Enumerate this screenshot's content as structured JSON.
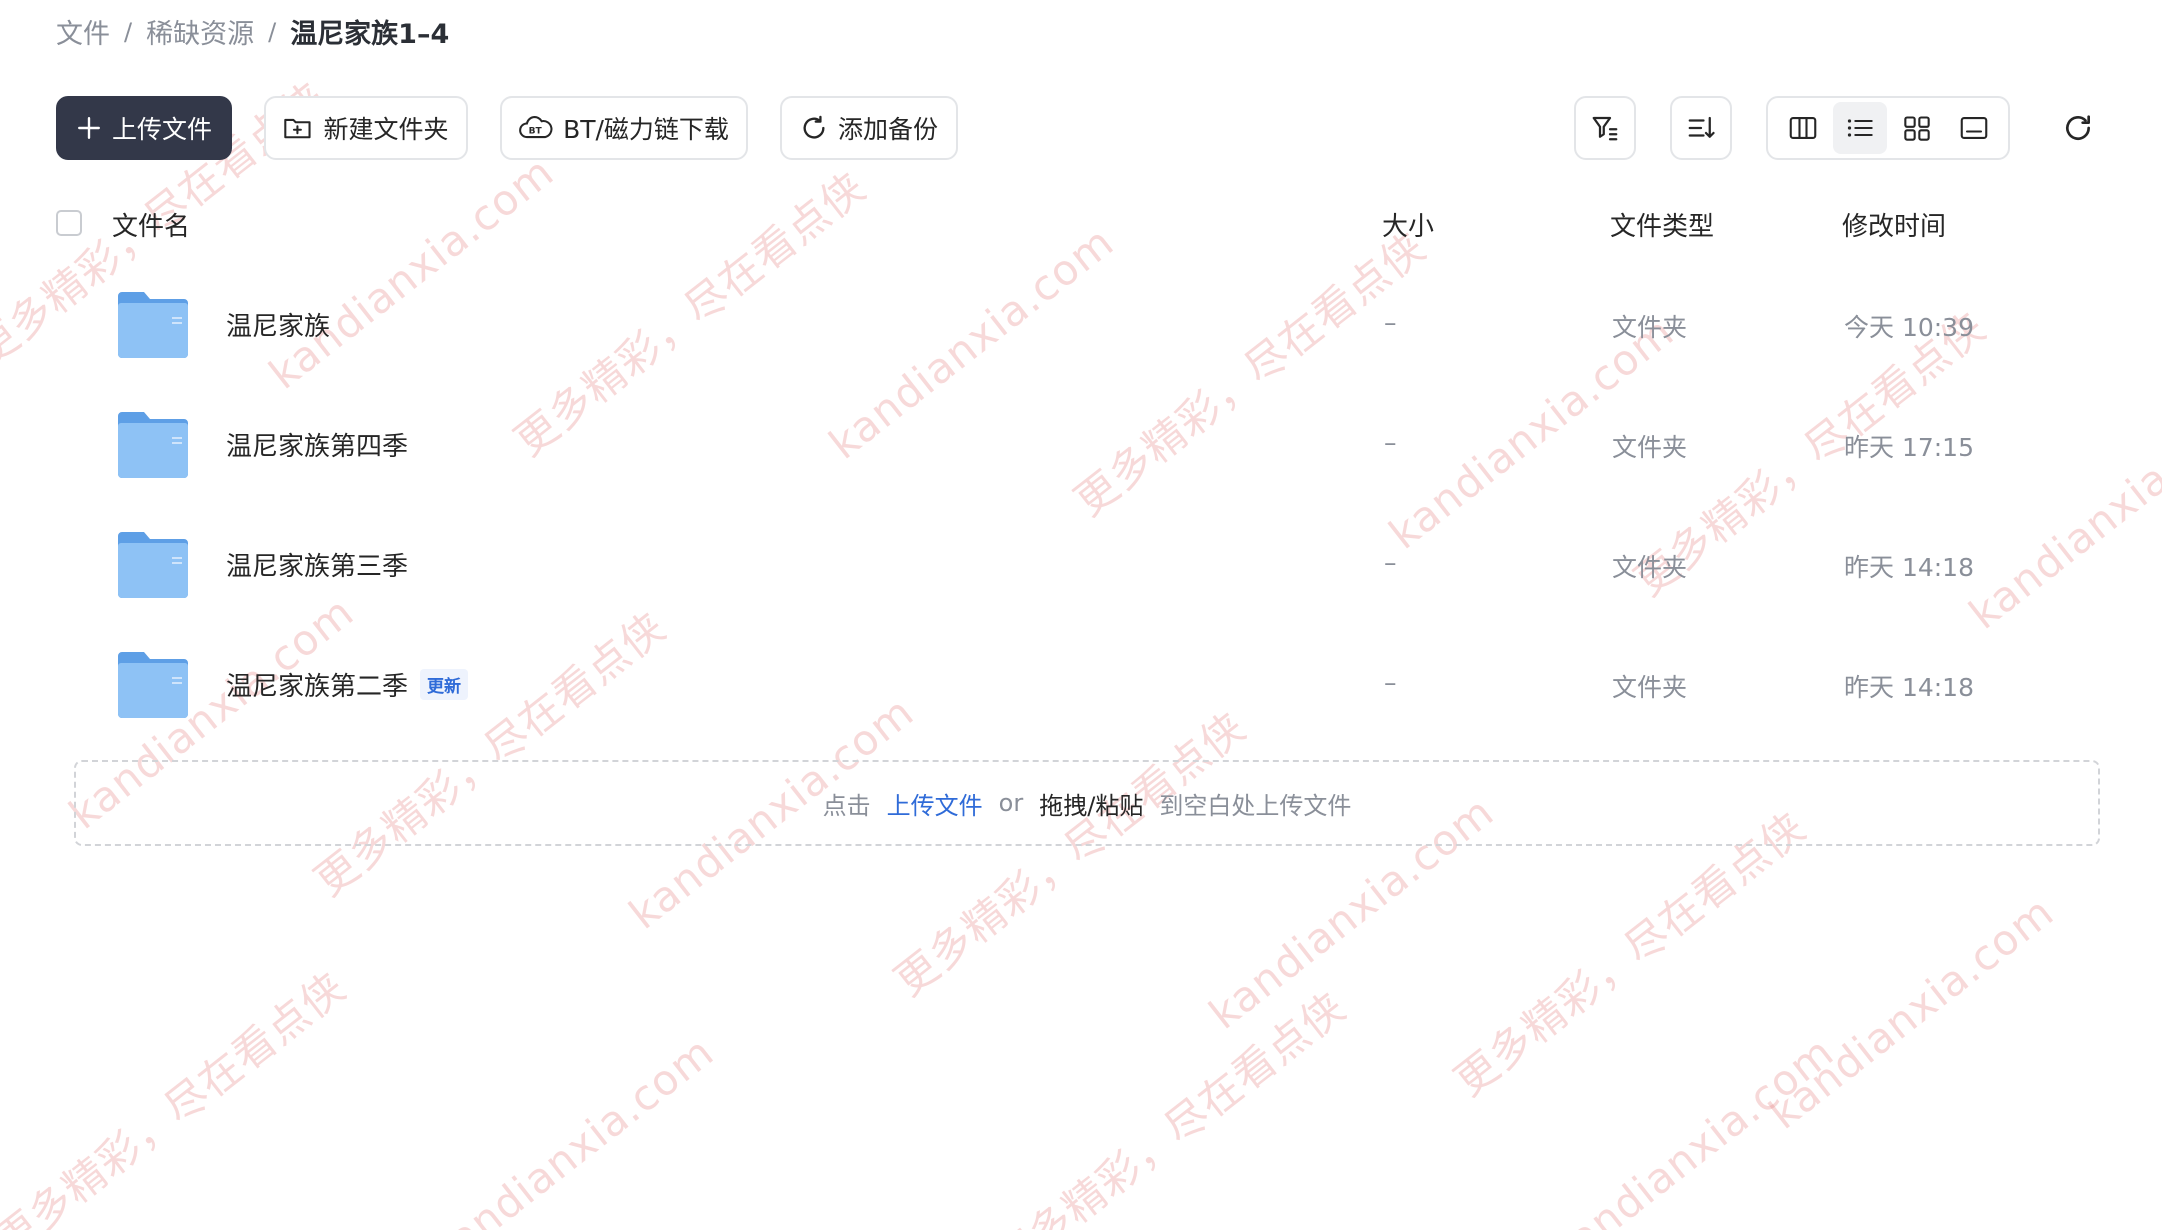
{
  "breadcrumb": [
    "文件",
    "稀缺资源",
    "温尼家族1–4"
  ],
  "toolbar": {
    "upload_label": "上传文件",
    "new_folder_label": "新建文件夹",
    "bt_download_label": "BT/磁力链下载",
    "add_backup_label": "添加备份"
  },
  "table": {
    "headers": {
      "name": "文件名",
      "size": "大小",
      "type": "文件类型",
      "modified": "修改时间"
    },
    "rows": [
      {
        "name": "温尼家族",
        "size": "–",
        "type": "文件夹",
        "modified": "今天 10:39",
        "badge": ""
      },
      {
        "name": "温尼家族第四季",
        "size": "–",
        "type": "文件夹",
        "modified": "昨天 17:15",
        "badge": ""
      },
      {
        "name": "温尼家族第三季",
        "size": "–",
        "type": "文件夹",
        "modified": "昨天 14:18",
        "badge": ""
      },
      {
        "name": "温尼家族第二季",
        "size": "–",
        "type": "文件夹",
        "modified": "昨天 14:18",
        "badge": "更新"
      }
    ]
  },
  "dropzone": {
    "prefix": "点击",
    "upload_link": "上传文件",
    "or": "or",
    "drag_paste": "拖拽/粘贴",
    "suffix": "到空白处上传文件"
  },
  "watermark": {
    "text_a": "更多精彩，尽在看点侠",
    "text_b": "kandianxia.com",
    "color": "#e27878"
  },
  "colors": {
    "primary_button": "#333849",
    "link": "#2f6bd8",
    "folder": "#6aa8ea"
  },
  "icons": {
    "upload": "plus-icon",
    "new_folder": "folder-plus-icon",
    "bt": "bt-icon",
    "backup": "sync-icon",
    "filter": "filter-icon",
    "sort": "sort-icon",
    "columns_view": "columns-view-icon",
    "list_view": "list-view-icon",
    "grid_view": "grid-view-icon",
    "preview_view": "preview-view-icon",
    "refresh": "refresh-icon"
  }
}
